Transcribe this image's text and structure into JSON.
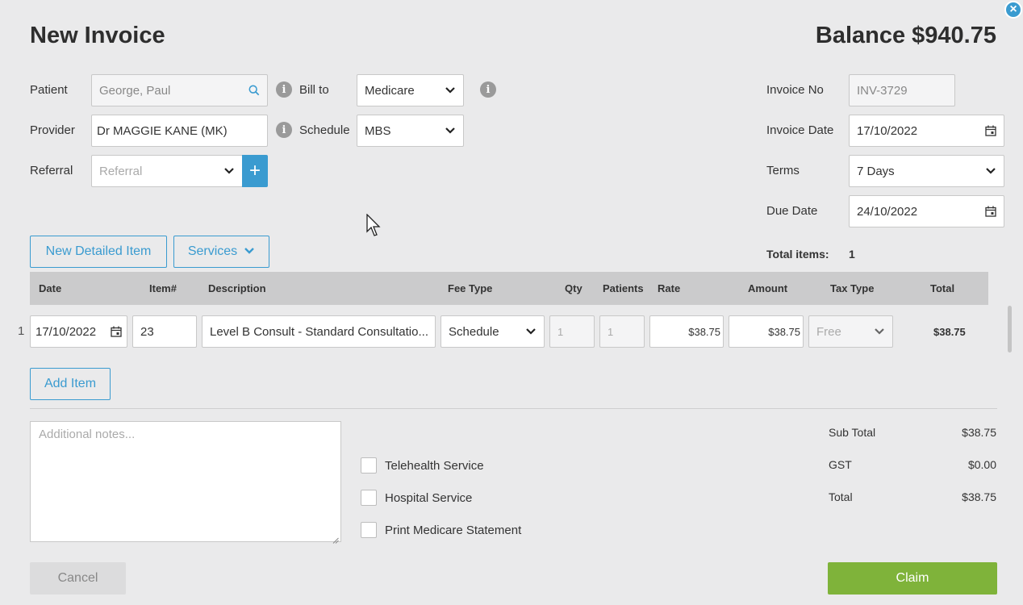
{
  "header": {
    "title": "New Invoice",
    "balance": "Balance $940.75",
    "close_icon": "close-icon"
  },
  "form": {
    "patient_label": "Patient",
    "patient_value": "George, Paul",
    "bill_to_label": "Bill to",
    "bill_to_value": "Medicare",
    "provider_label": "Provider",
    "provider_value": "Dr MAGGIE KANE (MK)",
    "schedule_label": "Schedule",
    "schedule_value": "MBS",
    "referral_label": "Referral",
    "referral_placeholder": "Referral",
    "plus_glyph": "+"
  },
  "invoice_meta": {
    "invoice_no_label": "Invoice No",
    "invoice_no_value": "INV-3729",
    "invoice_date_label": "Invoice Date",
    "invoice_date_value": "17/10/2022",
    "terms_label": "Terms",
    "terms_value": "7 Days",
    "due_date_label": "Due Date",
    "due_date_value": "24/10/2022",
    "total_items_label": "Total items:",
    "total_items_value": "1"
  },
  "actions": {
    "new_detailed_item": "New Detailed Item",
    "services": "Services",
    "add_item": "Add Item",
    "cancel": "Cancel",
    "claim": "Claim"
  },
  "table": {
    "headers": [
      "Date",
      "Item#",
      "Description",
      "Fee Type",
      "Qty",
      "Patients",
      "Rate",
      "Amount",
      "Tax Type",
      "Total"
    ],
    "rows": [
      {
        "index": "1",
        "date": "17/10/2022",
        "item": "23",
        "description": "Level B Consult - Standard Consultatio...",
        "fee_type": "Schedule",
        "qty": "1",
        "patients": "1",
        "rate": "$38.75",
        "amount": "$38.75",
        "tax_type": "Free",
        "total": "$38.75"
      }
    ]
  },
  "notes": {
    "placeholder": "Additional notes..."
  },
  "checkboxes": {
    "telehealth": "Telehealth Service",
    "hospital": "Hospital Service",
    "print_medicare": "Print Medicare Statement"
  },
  "summary": {
    "sub_total_label": "Sub Total",
    "sub_total_value": "$38.75",
    "gst_label": "GST",
    "gst_value": "$0.00",
    "total_label": "Total",
    "total_value": "$38.75"
  },
  "colors": {
    "accent": "#3a9bd0",
    "claim": "#7fb33a",
    "background": "#eaeaeb"
  }
}
